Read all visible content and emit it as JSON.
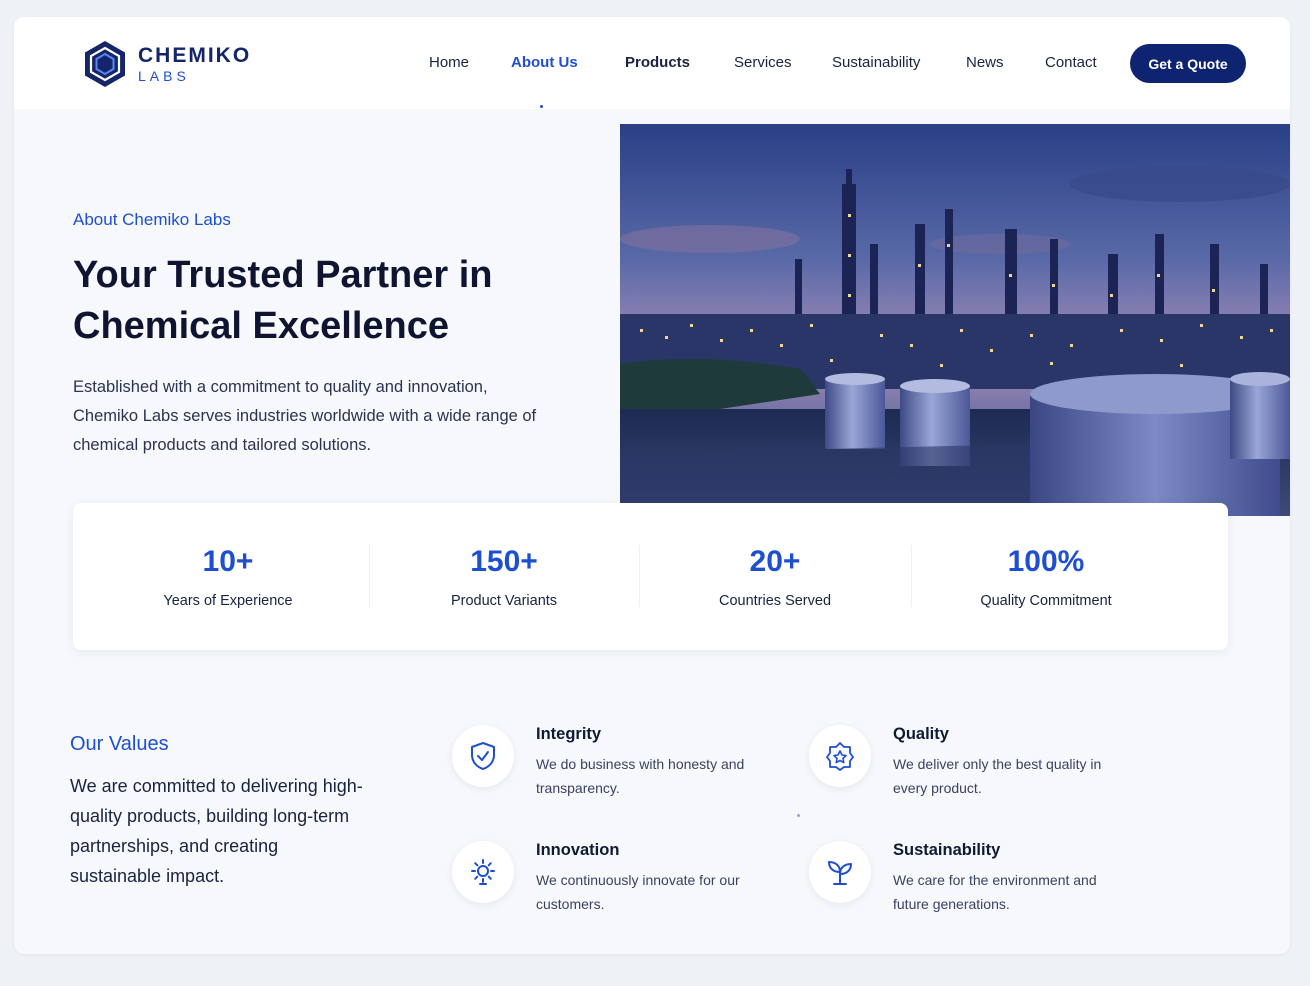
{
  "colors": {
    "accent": "#1f4fd1",
    "brand_dark": "#0f2470",
    "text": "#111a33"
  },
  "brand": {
    "name": "CHEMIKO",
    "sub": "LABS",
    "icon": "hexagon-logo-icon"
  },
  "nav": {
    "items": [
      "Home",
      "About Us",
      "Products",
      "Services",
      "Sustainability",
      "News",
      "Contact"
    ],
    "active": "About Us",
    "cta": "Get a Quote"
  },
  "hero": {
    "eyebrow": "About Chemiko Labs",
    "title": "Your Trusted Partner in Chemical Excellence",
    "text": "Established with a commitment to quality and innovation, Chemiko Labs serves industries worldwide with a wide range of chemical products and tailored solutions.",
    "image": "chemical-plant-at-dusk"
  },
  "stats": [
    {
      "value": "10+",
      "label": "Years of Experience"
    },
    {
      "value": "150+",
      "label": "Product Variants"
    },
    {
      "value": "20+",
      "label": "Countries Served"
    },
    {
      "value": "100%",
      "label": "Quality Commitment"
    }
  ],
  "values": {
    "heading": "Our Values",
    "text": "We are committed to delivering high-quality products, building long-term partnerships, and creating sustainable impact.",
    "items": [
      {
        "title": "Integrity",
        "desc": "We do business with honesty and transparency.",
        "icon": "shield-check-icon"
      },
      {
        "title": "Quality",
        "desc": "We deliver only the best quality in every product.",
        "icon": "quality-badge-icon"
      },
      {
        "title": "Innovation",
        "desc": "We continuously innovate for our customers.",
        "icon": "innovation-gear-icon"
      },
      {
        "title": "Sustainability",
        "desc": "We care for the environment and future generations.",
        "icon": "sprout-icon"
      }
    ]
  }
}
